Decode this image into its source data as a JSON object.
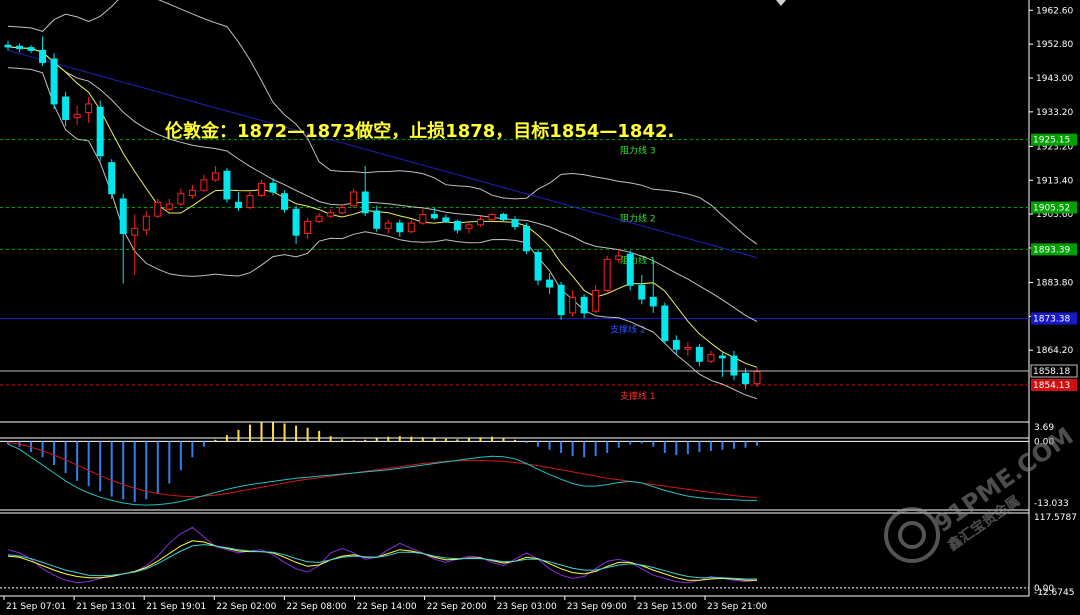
{
  "headline": "伦敦金：1872—1873做空，止损1878，目标1854—1842.",
  "colors": {
    "bull": "#ff2020",
    "bear": "#00e8ee",
    "upper_band": "#c0c0c0",
    "ma_fast": "#f0f060",
    "ma_long": "#2020c0",
    "resistance": "#00a000",
    "support_blue": "#1818c8",
    "support_red": "#d01010",
    "macd_pos": "#ffe040",
    "macd_neg": "#2f80f0",
    "signal": "#d01818",
    "macd_line": "#20c0c0",
    "stoch_purple": "#8a2be2",
    "stoch_yellow": "#ffff40",
    "stoch_cyan": "#40d0d0"
  },
  "price_axis": {
    "ticks": [
      "1962.60",
      "1952.80",
      "1943.00",
      "1933.20",
      "1923.20",
      "1913.40",
      "1903.60",
      "1893.80",
      "1883.80",
      "1874.00",
      "1864.20"
    ],
    "min": 1844,
    "max": 1965
  },
  "levels": [
    {
      "label": "阻力线 3",
      "price": 1925.15,
      "tag": "1925.15",
      "kind": "resistance"
    },
    {
      "label": "阻力线 2",
      "price": 1905.52,
      "tag": "1905.52",
      "kind": "resistance"
    },
    {
      "label": "阻力线 1",
      "price": 1893.39,
      "tag": "1893.39",
      "kind": "resistance"
    },
    {
      "label": "支撑线 2",
      "price": 1873.38,
      "tag": "1873.38",
      "kind": "support_blue"
    },
    {
      "label": "支撑线 1",
      "price": 1854.13,
      "tag": "1854.13",
      "kind": "support_red"
    }
  ],
  "current_price": "1858.18",
  "candles": [
    {
      "o": 1952.5,
      "h": 1953.8,
      "l": 1951.0,
      "c": 1952.0
    },
    {
      "o": 1952.2,
      "h": 1953.0,
      "l": 1950.5,
      "c": 1951.5
    },
    {
      "o": 1951.8,
      "h": 1952.5,
      "l": 1950.2,
      "c": 1951.0
    },
    {
      "o": 1951.0,
      "h": 1955.0,
      "l": 1946.5,
      "c": 1947.5
    },
    {
      "o": 1948.5,
      "h": 1950.2,
      "l": 1934.0,
      "c": 1935.5
    },
    {
      "o": 1937.5,
      "h": 1939.0,
      "l": 1929.0,
      "c": 1931.0
    },
    {
      "o": 1931.5,
      "h": 1935.0,
      "l": 1929.5,
      "c": 1932.5
    },
    {
      "o": 1933.0,
      "h": 1937.5,
      "l": 1930.0,
      "c": 1935.5
    },
    {
      "o": 1934.5,
      "h": 1936.5,
      "l": 1919.0,
      "c": 1920.5
    },
    {
      "o": 1918.5,
      "h": 1919.5,
      "l": 1908.0,
      "c": 1909.5
    },
    {
      "o": 1908.0,
      "h": 1909.5,
      "l": 1883.5,
      "c": 1898.0
    },
    {
      "o": 1897.5,
      "h": 1903.5,
      "l": 1886.0,
      "c": 1899.5
    },
    {
      "o": 1899.0,
      "h": 1904.5,
      "l": 1897.5,
      "c": 1903.0
    },
    {
      "o": 1903.0,
      "h": 1908.0,
      "l": 1902.5,
      "c": 1907.0
    },
    {
      "o": 1905.0,
      "h": 1908.0,
      "l": 1904.5,
      "c": 1906.5
    },
    {
      "o": 1906.5,
      "h": 1911.0,
      "l": 1906.0,
      "c": 1909.5
    },
    {
      "o": 1909.0,
      "h": 1912.0,
      "l": 1908.0,
      "c": 1910.5
    },
    {
      "o": 1910.5,
      "h": 1915.0,
      "l": 1910.0,
      "c": 1913.5
    },
    {
      "o": 1913.5,
      "h": 1917.5,
      "l": 1913.0,
      "c": 1915.5
    },
    {
      "o": 1916.0,
      "h": 1917.0,
      "l": 1907.0,
      "c": 1908.0
    },
    {
      "o": 1907.0,
      "h": 1910.0,
      "l": 1904.5,
      "c": 1905.5
    },
    {
      "o": 1905.5,
      "h": 1910.0,
      "l": 1905.0,
      "c": 1909.0
    },
    {
      "o": 1909.0,
      "h": 1913.5,
      "l": 1908.5,
      "c": 1912.5
    },
    {
      "o": 1912.5,
      "h": 1914.0,
      "l": 1909.0,
      "c": 1910.0
    },
    {
      "o": 1909.5,
      "h": 1910.5,
      "l": 1904.0,
      "c": 1905.0
    },
    {
      "o": 1905.0,
      "h": 1906.0,
      "l": 1895.0,
      "c": 1897.5
    },
    {
      "o": 1898.0,
      "h": 1902.5,
      "l": 1896.5,
      "c": 1901.5
    },
    {
      "o": 1901.5,
      "h": 1904.0,
      "l": 1901.0,
      "c": 1903.0
    },
    {
      "o": 1903.0,
      "h": 1905.0,
      "l": 1902.5,
      "c": 1904.0
    },
    {
      "o": 1904.0,
      "h": 1906.5,
      "l": 1903.5,
      "c": 1905.5
    },
    {
      "o": 1906.0,
      "h": 1911.0,
      "l": 1905.5,
      "c": 1910.0
    },
    {
      "o": 1910.0,
      "h": 1917.5,
      "l": 1903.0,
      "c": 1904.0
    },
    {
      "o": 1904.5,
      "h": 1906.0,
      "l": 1898.5,
      "c": 1899.5
    },
    {
      "o": 1899.5,
      "h": 1902.0,
      "l": 1898.0,
      "c": 1901.0
    },
    {
      "o": 1901.0,
      "h": 1902.0,
      "l": 1897.0,
      "c": 1898.5
    },
    {
      "o": 1898.5,
      "h": 1902.0,
      "l": 1898.0,
      "c": 1901.0
    },
    {
      "o": 1901.0,
      "h": 1905.0,
      "l": 1900.5,
      "c": 1903.5
    },
    {
      "o": 1903.5,
      "h": 1905.5,
      "l": 1902.0,
      "c": 1902.5
    },
    {
      "o": 1902.5,
      "h": 1903.5,
      "l": 1901.0,
      "c": 1901.5
    },
    {
      "o": 1901.5,
      "h": 1902.0,
      "l": 1898.0,
      "c": 1899.0
    },
    {
      "o": 1899.5,
      "h": 1901.0,
      "l": 1898.0,
      "c": 1900.5
    },
    {
      "o": 1900.5,
      "h": 1903.0,
      "l": 1900.0,
      "c": 1902.0
    },
    {
      "o": 1902.0,
      "h": 1904.0,
      "l": 1901.5,
      "c": 1903.5
    },
    {
      "o": 1903.5,
      "h": 1904.0,
      "l": 1901.5,
      "c": 1902.0
    },
    {
      "o": 1902.0,
      "h": 1903.0,
      "l": 1899.0,
      "c": 1900.0
    },
    {
      "o": 1900.0,
      "h": 1901.0,
      "l": 1892.0,
      "c": 1893.0
    },
    {
      "o": 1892.5,
      "h": 1893.5,
      "l": 1883.0,
      "c": 1884.5
    },
    {
      "o": 1884.5,
      "h": 1886.5,
      "l": 1880.5,
      "c": 1882.5
    },
    {
      "o": 1883.0,
      "h": 1884.0,
      "l": 1873.0,
      "c": 1874.5
    },
    {
      "o": 1875.0,
      "h": 1881.5,
      "l": 1874.0,
      "c": 1879.5
    },
    {
      "o": 1879.5,
      "h": 1880.5,
      "l": 1873.5,
      "c": 1875.0
    },
    {
      "o": 1875.5,
      "h": 1883.0,
      "l": 1875.0,
      "c": 1881.5
    },
    {
      "o": 1881.5,
      "h": 1891.5,
      "l": 1881.0,
      "c": 1890.5
    },
    {
      "o": 1890.5,
      "h": 1893.5,
      "l": 1889.5,
      "c": 1891.5
    },
    {
      "o": 1892.0,
      "h": 1893.0,
      "l": 1881.5,
      "c": 1883.0
    },
    {
      "o": 1883.0,
      "h": 1886.0,
      "l": 1877.5,
      "c": 1879.0
    },
    {
      "o": 1879.5,
      "h": 1890.5,
      "l": 1875.0,
      "c": 1877.0
    },
    {
      "o": 1877.0,
      "h": 1878.0,
      "l": 1866.0,
      "c": 1867.0
    },
    {
      "o": 1867.0,
      "h": 1868.5,
      "l": 1863.0,
      "c": 1864.5
    },
    {
      "o": 1864.5,
      "h": 1866.5,
      "l": 1862.5,
      "c": 1865.0
    },
    {
      "o": 1865.0,
      "h": 1866.0,
      "l": 1859.5,
      "c": 1861.0
    },
    {
      "o": 1861.0,
      "h": 1864.0,
      "l": 1860.5,
      "c": 1863.0
    },
    {
      "o": 1862.5,
      "h": 1863.5,
      "l": 1856.5,
      "c": 1862.0
    },
    {
      "o": 1862.5,
      "h": 1864.0,
      "l": 1855.5,
      "c": 1857.0
    },
    {
      "o": 1857.5,
      "h": 1859.0,
      "l": 1853.0,
      "c": 1854.5
    },
    {
      "o": 1854.5,
      "h": 1859.0,
      "l": 1853.5,
      "c": 1858.0
    }
  ],
  "macd": {
    "axis_top": "3.69",
    "axis_zero": "0.00",
    "axis_bottom": "-13.033",
    "min": -13.033,
    "max": 3.69,
    "hist": [
      -0.5,
      -1.0,
      -2.0,
      -3.0,
      -4.5,
      -6.0,
      -7.5,
      -8.5,
      -9.5,
      -10.5,
      -11.0,
      -11.5,
      -11.0,
      -10.0,
      -8.0,
      -5.5,
      -3.0,
      -1.0,
      0.3,
      1.2,
      2.2,
      3.2,
      3.6,
      3.6,
      3.4,
      3.0,
      2.6,
      2.0,
      1.0,
      0.4,
      0.2,
      0.3,
      0.6,
      0.9,
      1.0,
      0.9,
      0.8,
      0.6,
      0.5,
      0.4,
      0.6,
      0.8,
      0.9,
      0.7,
      0.3,
      -0.3,
      -1.0,
      -1.6,
      -2.2,
      -2.8,
      -3.0,
      -2.8,
      -2.2,
      -1.2,
      -0.6,
      -0.4,
      -1.0,
      -2.2,
      -2.6,
      -2.4,
      -2.0,
      -1.8,
      -1.6,
      -1.4,
      -1.2,
      -0.8
    ],
    "signal": [
      -0.2,
      -0.5,
      -1.1,
      -1.8,
      -2.6,
      -3.5,
      -4.5,
      -5.5,
      -6.5,
      -7.4,
      -8.2,
      -8.9,
      -9.5,
      -9.9,
      -10.2,
      -10.4,
      -10.5,
      -10.4,
      -10.2,
      -9.9,
      -9.5,
      -9.1,
      -8.7,
      -8.3,
      -7.9,
      -7.5,
      -7.2,
      -6.9,
      -6.6,
      -6.3,
      -6.0,
      -5.7,
      -5.4,
      -5.1,
      -4.8,
      -4.5,
      -4.2,
      -4.0,
      -3.8,
      -3.7,
      -3.6,
      -3.6,
      -3.7,
      -3.8,
      -4.0,
      -4.3,
      -4.6,
      -5.0,
      -5.4,
      -5.8,
      -6.2,
      -6.6,
      -7.0,
      -7.3,
      -7.6,
      -7.9,
      -8.2,
      -8.5,
      -8.8,
      -9.1,
      -9.4,
      -9.7,
      -10.0,
      -10.3,
      -10.5,
      -10.7
    ],
    "main": [
      -0.5,
      -1.5,
      -3.0,
      -4.5,
      -6.0,
      -7.5,
      -8.8,
      -9.8,
      -10.6,
      -11.2,
      -11.7,
      -12.0,
      -12.1,
      -12.0,
      -11.8,
      -11.4,
      -10.9,
      -10.3,
      -9.7,
      -9.1,
      -8.6,
      -8.2,
      -7.9,
      -7.6,
      -7.3,
      -7.0,
      -6.8,
      -6.6,
      -6.4,
      -6.2,
      -6.0,
      -5.8,
      -5.6,
      -5.4,
      -5.1,
      -4.8,
      -4.5,
      -4.2,
      -3.9,
      -3.6,
      -3.3,
      -3.0,
      -2.8,
      -2.9,
      -3.3,
      -4.2,
      -5.3,
      -6.3,
      -7.2,
      -8.0,
      -8.5,
      -8.5,
      -8.2,
      -7.8,
      -7.6,
      -7.9,
      -8.6,
      -9.3,
      -9.9,
      -10.4,
      -10.7,
      -10.9,
      -11.0,
      -11.1,
      -11.2,
      -11.2
    ]
  },
  "stoch": {
    "axis_top": "117.5787",
    "axis_zero": "0.00",
    "axis_bottom": "-12.6745",
    "min": -12.6745,
    "max": 117.5787,
    "purple": [
      60,
      55,
      45,
      30,
      20,
      12,
      8,
      10,
      15,
      20,
      22,
      25,
      35,
      50,
      70,
      85,
      95,
      80,
      65,
      60,
      55,
      58,
      60,
      52,
      40,
      30,
      25,
      35,
      55,
      62,
      55,
      45,
      48,
      60,
      70,
      62,
      55,
      45,
      40,
      45,
      50,
      48,
      40,
      35,
      45,
      55,
      45,
      30,
      20,
      15,
      18,
      30,
      42,
      45,
      40,
      30,
      20,
      15,
      10,
      8,
      12,
      18,
      15,
      12,
      10,
      12
    ],
    "yellow": [
      50,
      48,
      42,
      35,
      28,
      22,
      18,
      16,
      16,
      18,
      22,
      26,
      32,
      42,
      54,
      66,
      74,
      72,
      66,
      62,
      58,
      57,
      57,
      55,
      48,
      40,
      34,
      36,
      44,
      50,
      52,
      48,
      48,
      54,
      60,
      58,
      54,
      48,
      44,
      45,
      47,
      47,
      43,
      39,
      42,
      48,
      46,
      38,
      30,
      24,
      22,
      26,
      34,
      40,
      40,
      35,
      28,
      22,
      16,
      12,
      12,
      14,
      15,
      14,
      12,
      12
    ],
    "cyan": [
      52,
      50,
      46,
      40,
      34,
      28,
      24,
      20,
      19,
      20,
      22,
      25,
      30,
      38,
      48,
      58,
      66,
      68,
      66,
      63,
      60,
      58,
      57,
      56,
      52,
      46,
      41,
      40,
      44,
      48,
      50,
      49,
      48,
      51,
      56,
      56,
      54,
      50,
      47,
      46,
      46,
      46,
      44,
      41,
      42,
      45,
      45,
      41,
      36,
      31,
      28,
      28,
      32,
      36,
      38,
      36,
      32,
      27,
      22,
      18,
      16,
      16,
      16,
      15,
      14,
      14
    ]
  },
  "time_labels": [
    "21 Sep 07:01",
    "21 Sep 13:01",
    "21 Sep 19:01",
    "22 Sep 02:00",
    "22 Sep 08:00",
    "22 Sep 14:00",
    "22 Sep 20:00",
    "23 Sep 03:00",
    "23 Sep 09:00",
    "23 Sep 15:00",
    "23 Sep 21:00"
  ],
  "watermark": {
    "brand": "91PME.COM",
    "subtitle": "鑫汇宝贵金属"
  }
}
